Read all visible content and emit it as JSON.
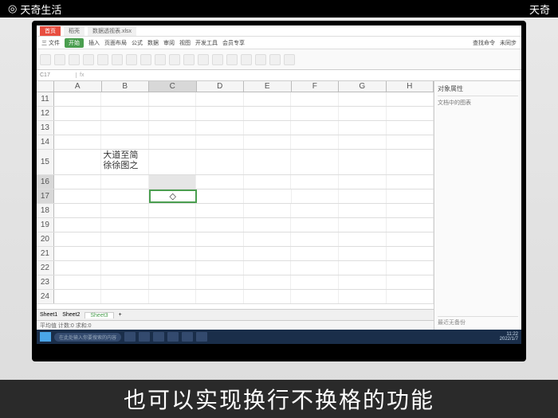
{
  "top_left_logo": "天奇生活",
  "top_right_text": "天奇",
  "title_tab1": "首页",
  "title_tab2": "稻壳",
  "filename": "数据透视表.xlsx",
  "menu": {
    "file": "三 文件",
    "start": "开始",
    "insert": "插入",
    "layout": "页面布局",
    "formula": "公式",
    "data": "数据",
    "review": "审阅",
    "view": "视图",
    "dev": "开发工具",
    "member": "会员专享"
  },
  "ribbon_search": "查找命令",
  "ribbon_right": "未同步",
  "namebox": "C17",
  "side": {
    "header": "对象属性",
    "section": "文档中的图表",
    "footer1": "最近无备份",
    "footer2": "一"
  },
  "columns": [
    "A",
    "B",
    "C",
    "D",
    "E",
    "F",
    "G",
    "H"
  ],
  "rows": [
    "11",
    "12",
    "13",
    "14",
    "15",
    "16",
    "17",
    "18",
    "19",
    "20",
    "21",
    "22",
    "23",
    "24"
  ],
  "cell_b15_line1": "大道至简",
  "cell_b15_line2": "徐徐图之",
  "sheets": {
    "s1": "Sheet1",
    "s2": "Sheet2",
    "s3": "Sheet3"
  },
  "status_left": "平均值 计数:0 求和:0",
  "status_hint": "在此处输入你要搜索的内容",
  "taskbar_time": "11:22",
  "taskbar_date": "2022/1/7",
  "subtitle": "也可以实现换行不换格的功能",
  "chart_data": {
    "type": "table",
    "note": "Spreadsheet with one populated multi-line cell B15 and active selection on C16:C17"
  }
}
